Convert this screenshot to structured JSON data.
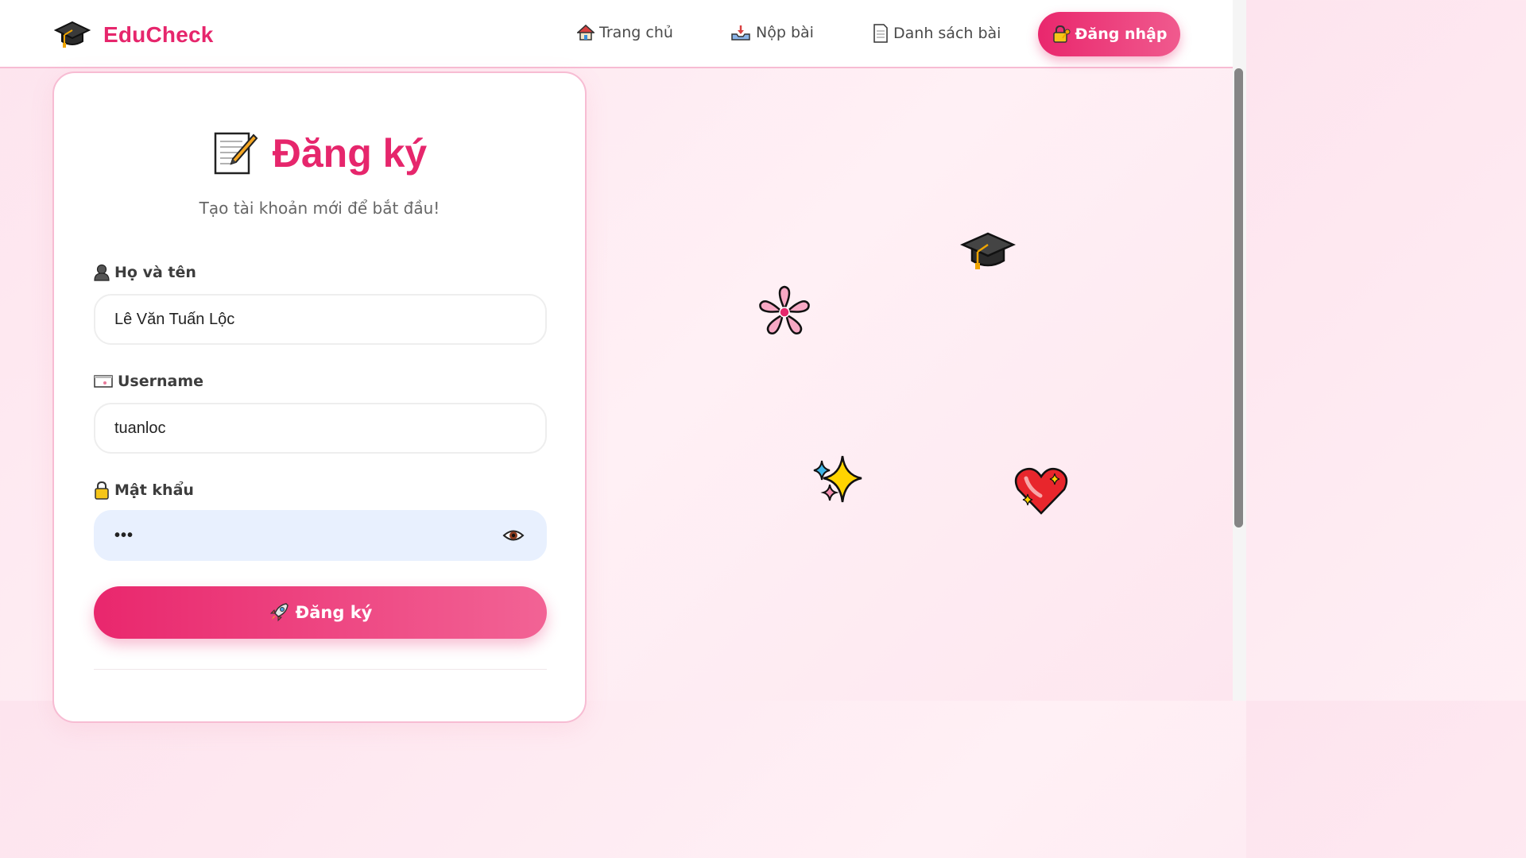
{
  "app": {
    "brand_name": "EduCheck",
    "brand_icon": "graduation-cap-icon",
    "accent_color": "#e6266c"
  },
  "nav": {
    "items": [
      {
        "label": "Trang chủ",
        "icon": "house-icon"
      },
      {
        "label": "Nộp bài",
        "icon": "inbox-tray-icon"
      },
      {
        "label": "Danh sách bài",
        "icon": "page-icon"
      }
    ],
    "login_label": "Đăng nhập",
    "login_icon": "lock-with-key-icon"
  },
  "form": {
    "title": "Đăng ký",
    "title_icon": "memo-icon",
    "subtitle": "Tạo tài khoản mới để bắt đầu!",
    "fields": [
      {
        "label": "Họ và tên",
        "icon": "bust-silhouette-icon",
        "value": "Lê Văn Tuấn Lộc"
      },
      {
        "label": "Username",
        "icon": "id-card-icon",
        "value": "tuanloc"
      },
      {
        "label": "Mật khẩu",
        "icon": "lock-icon",
        "value": "•••",
        "type": "password"
      }
    ],
    "submit_label": "Đăng ký",
    "submit_icon": "rocket-icon"
  },
  "decorations": [
    "graduation-cap-icon",
    "cherry-blossom-icon",
    "sparkles-icon",
    "sparkling-heart-icon"
  ]
}
